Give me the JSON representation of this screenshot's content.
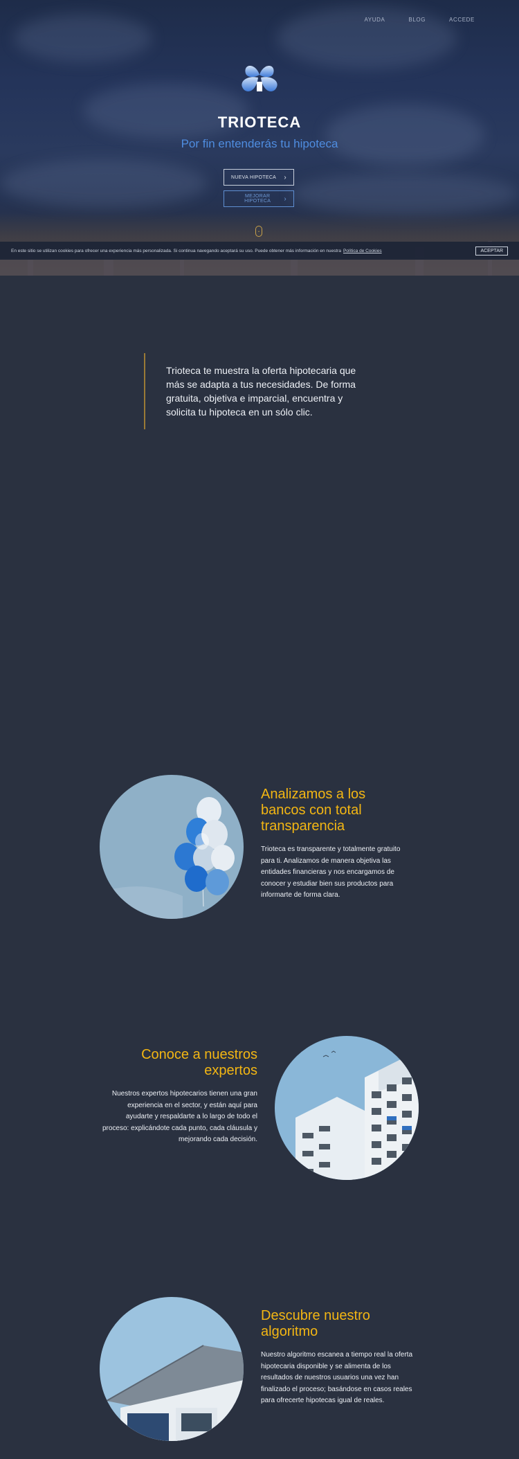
{
  "nav": {
    "items": [
      "AYUDA",
      "BLOG",
      "ACCEDE"
    ]
  },
  "hero": {
    "brand": "TRIOTECA",
    "tagline": "Por fin entenderás tu hipoteca",
    "primary_button": "NUEVA HIPOTECA",
    "secondary_button": "MEJORAR HIPOTECA"
  },
  "cookie": {
    "text": "En este sitio se utilizan cookies para ofrecer una experiencia más personalizada. Si continua navegando aceptará su uso. Puede obtener más información en nuestra",
    "link": "Política de Cookies",
    "accept": "ACEPTAR"
  },
  "intro": {
    "text": "Trioteca te muestra la oferta hipotecaria que más se adapta a tus necesidades. De forma gratuita, objetiva e imparcial, encuentra y solicita tu hipoteca en un sólo clic."
  },
  "features": [
    {
      "title": "Analizamos a los bancos con total transparencia",
      "text": "Trioteca es transparente y totalmente gratuito para ti. Analizamos de manera objetiva las entidades financieras y nos encargamos de conocer y estudiar bien sus productos para informarte de forma clara.",
      "image_icon": "balloons-image"
    },
    {
      "title": "Conoce a nuestros expertos",
      "text": "Nuestros expertos hipotecarios tienen una gran experiencia en el sector, y están aquí para ayudarte y respaldarte a lo largo de todo el proceso: explicándote cada punto, cada cláusula y mejorando cada decisión.",
      "image_icon": "building-image"
    },
    {
      "title": "Descubre nuestro algoritmo",
      "text": "Nuestro algoritmo escanea a tiempo real la oferta hipotecaria disponible y se alimenta de los resultados de nuestros usuarios una vez han finalizado el proceso; basándose en casos reales para ofrecerte hipotecas igual de reales.",
      "image_icon": "house-roof-image"
    }
  ],
  "colors": {
    "page_bg": "#2a3140",
    "accent_yellow": "#f3b613",
    "tagline_blue": "#4f8de0",
    "quote_line": "#9a7a35"
  }
}
